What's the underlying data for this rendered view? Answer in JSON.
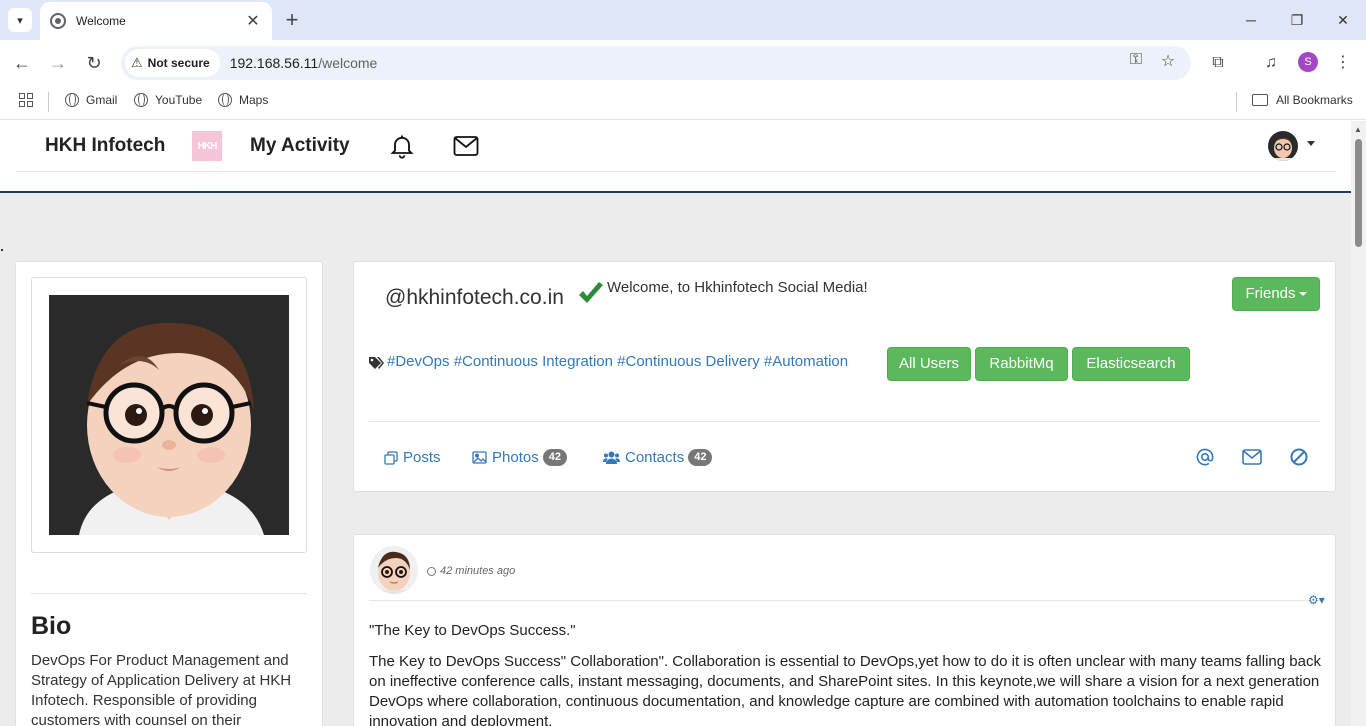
{
  "browser": {
    "tab_title": "Welcome",
    "security_label": "Not secure",
    "url_host": "192.168.56.11",
    "url_path": "/welcome",
    "profile_initial": "S",
    "bookmarks": [
      {
        "label": "Gmail"
      },
      {
        "label": "YouTube"
      },
      {
        "label": "Maps"
      }
    ],
    "all_bookmarks_label": "All Bookmarks"
  },
  "site_nav": {
    "brand": "HKH Infotech",
    "logo_text": "HKH",
    "activity": "My Activity"
  },
  "profile": {
    "handle": "@hkhinfotech.co.in",
    "welcome": "Welcome, to Hkhinfotech Social Media!",
    "friends_label": "Friends",
    "tags": "#DevOps #Continuous Integration #Continuous Delivery #Automation",
    "buttons": [
      "All Users",
      "RabbitMq",
      "Elasticsearch"
    ],
    "tabs": {
      "posts": "Posts",
      "photos": "Photos",
      "photos_count": "42",
      "contacts": "Contacts",
      "contacts_count": "42"
    }
  },
  "bio": {
    "title": "Bio",
    "text": "DevOps For Product Management and Strategy of Application Delivery at HKH Infotech. Responsible of providing customers with counsel on their"
  },
  "post": {
    "time": "42 minutes ago",
    "title": "\"The Key to DevOps Success.\"",
    "body": "The Key to DevOps Success\" Collaboration\". Collaboration is essential to DevOps,yet how to do it is often unclear with many teams falling back on ineffective conference calls, instant messaging, documents, and SharePoint sites. In this keynote,we will share a vision for a next generation DevOps where collaboration, continuous documentation, and knowledge capture are combined with automation toolchains to enable rapid innovation and deployment."
  },
  "colors": {
    "green_button": "#5cb85c",
    "link_blue": "#337ab7",
    "nav_border": "#1b3c6d",
    "profile_purple": "#a347c6"
  }
}
